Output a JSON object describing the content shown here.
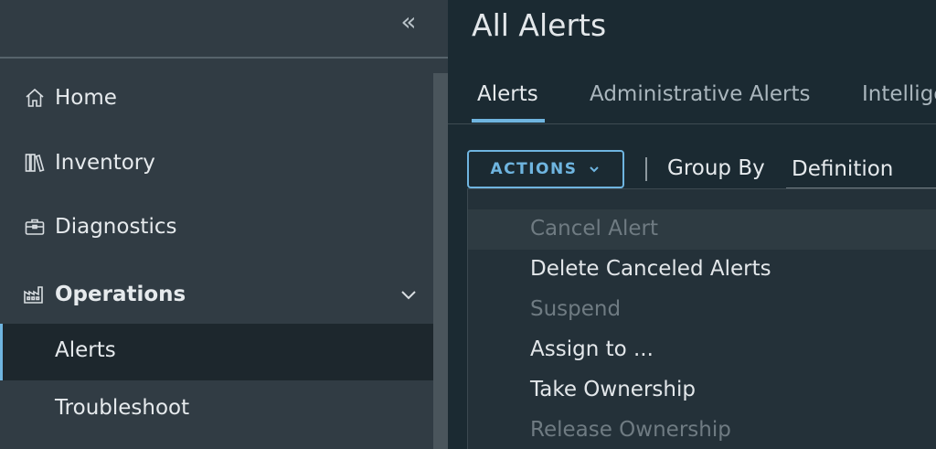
{
  "sidebar": {
    "collapse_glyph": "«",
    "items": [
      {
        "label": "Home",
        "icon": "home-icon"
      },
      {
        "label": "Inventory",
        "icon": "inventory-icon"
      },
      {
        "label": "Diagnostics",
        "icon": "diagnostics-icon"
      },
      {
        "label": "Operations",
        "icon": "operations-icon",
        "expanded": true
      }
    ],
    "subitems": [
      {
        "label": "Alerts",
        "active": true
      },
      {
        "label": "Troubleshoot",
        "active": false
      }
    ]
  },
  "main": {
    "title": "All Alerts",
    "tabs": [
      {
        "label": "Alerts",
        "active": true
      },
      {
        "label": "Administrative Alerts",
        "active": false
      },
      {
        "label": "Intellige",
        "active": false
      }
    ],
    "toolbar": {
      "actions_label": "ACTIONS",
      "group_by_label": "Group By",
      "group_by_value": "Definition"
    },
    "actions_menu": [
      {
        "label": "Cancel Alert",
        "enabled": false
      },
      {
        "label": "Delete Canceled Alerts",
        "enabled": true
      },
      {
        "label": "Suspend",
        "enabled": false
      },
      {
        "label": "Assign to ...",
        "enabled": true
      },
      {
        "label": "Take Ownership",
        "enabled": true
      },
      {
        "label": "Release Ownership",
        "enabled": false
      }
    ]
  },
  "colors": {
    "accent": "#6fb5e0",
    "sidebar_bg": "#313c44",
    "main_bg": "#1b2a32",
    "menu_bg": "#243139"
  }
}
